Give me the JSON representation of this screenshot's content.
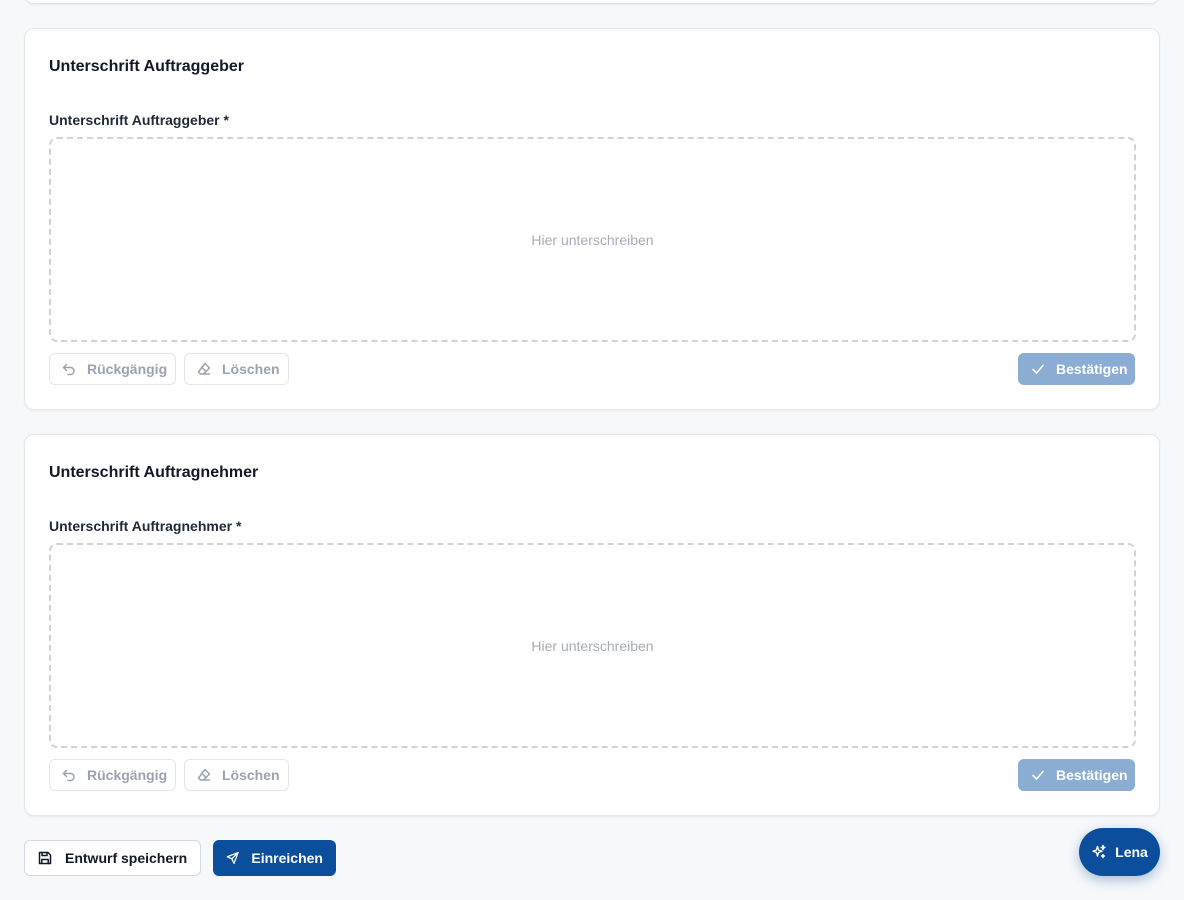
{
  "sections": [
    {
      "title": "Unterschrift Auftraggeber",
      "field_label": "Unterschrift Auftraggeber *",
      "placeholder": "Hier unterschreiben",
      "undo_label": "Rückgängig",
      "clear_label": "Löschen",
      "confirm_label": "Bestätigen"
    },
    {
      "title": "Unterschrift Auftragnehmer",
      "field_label": "Unterschrift Auftragnehmer *",
      "placeholder": "Hier unterschreiben",
      "undo_label": "Rückgängig",
      "clear_label": "Löschen",
      "confirm_label": "Bestätigen"
    }
  ],
  "footer": {
    "save_draft_label": "Entwurf speichern",
    "submit_label": "Einreichen"
  },
  "assistant": {
    "label": "Lena"
  },
  "colors": {
    "primary": "#0b4f9c",
    "confirm_disabled": "#8badd3",
    "page_background": "#f7f8fa"
  }
}
